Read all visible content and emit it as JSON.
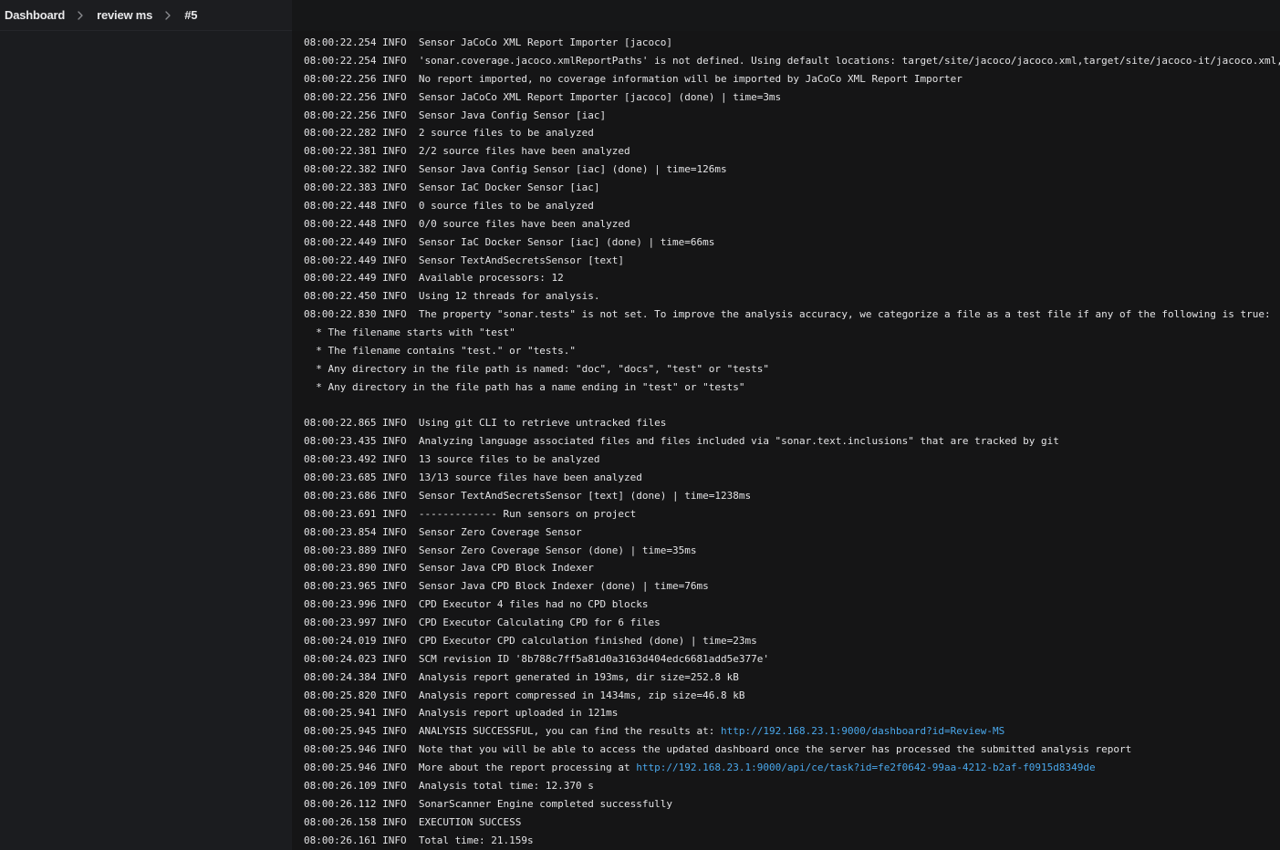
{
  "breadcrumb": {
    "items": [
      "Dashboard",
      "review ms",
      "#5"
    ]
  },
  "colors": {
    "link": "#4aa8ec",
    "text": "#e4e4e6",
    "console_bg": "#151516"
  },
  "log": {
    "lines": [
      {
        "text": "08:00:22.254 INFO  Sensor JaCoCo XML Report Importer [jacoco]"
      },
      {
        "text": "08:00:22.254 INFO  'sonar.coverage.jacoco.xmlReportPaths' is not defined. Using default locations: target/site/jacoco/jacoco.xml,target/site/jacoco-it/jacoco.xml,build/reports/jacoco/test/jacocoTestReport.xml"
      },
      {
        "text": "08:00:22.256 INFO  No report imported, no coverage information will be imported by JaCoCo XML Report Importer"
      },
      {
        "text": "08:00:22.256 INFO  Sensor JaCoCo XML Report Importer [jacoco] (done) | time=3ms"
      },
      {
        "text": "08:00:22.256 INFO  Sensor Java Config Sensor [iac]"
      },
      {
        "text": "08:00:22.282 INFO  2 source files to be analyzed"
      },
      {
        "text": "08:00:22.381 INFO  2/2 source files have been analyzed"
      },
      {
        "text": "08:00:22.382 INFO  Sensor Java Config Sensor [iac] (done) | time=126ms"
      },
      {
        "text": "08:00:22.383 INFO  Sensor IaC Docker Sensor [iac]"
      },
      {
        "text": "08:00:22.448 INFO  0 source files to be analyzed"
      },
      {
        "text": "08:00:22.448 INFO  0/0 source files have been analyzed"
      },
      {
        "text": "08:00:22.449 INFO  Sensor IaC Docker Sensor [iac] (done) | time=66ms"
      },
      {
        "text": "08:00:22.449 INFO  Sensor TextAndSecretsSensor [text]"
      },
      {
        "text": "08:00:22.449 INFO  Available processors: 12"
      },
      {
        "text": "08:00:22.450 INFO  Using 12 threads for analysis."
      },
      {
        "text": "08:00:22.830 INFO  The property \"sonar.tests\" is not set. To improve the analysis accuracy, we categorize a file as a test file if any of the following is true:"
      },
      {
        "text": "  * The filename starts with \"test\""
      },
      {
        "text": "  * The filename contains \"test.\" or \"tests.\""
      },
      {
        "text": "  * Any directory in the file path is named: \"doc\", \"docs\", \"test\" or \"tests\""
      },
      {
        "text": "  * Any directory in the file path has a name ending in \"test\" or \"tests\""
      },
      {
        "text": ""
      },
      {
        "text": "08:00:22.865 INFO  Using git CLI to retrieve untracked files"
      },
      {
        "text": "08:00:23.435 INFO  Analyzing language associated files and files included via \"sonar.text.inclusions\" that are tracked by git"
      },
      {
        "text": "08:00:23.492 INFO  13 source files to be analyzed"
      },
      {
        "text": "08:00:23.685 INFO  13/13 source files have been analyzed"
      },
      {
        "text": "08:00:23.686 INFO  Sensor TextAndSecretsSensor [text] (done) | time=1238ms"
      },
      {
        "text": "08:00:23.691 INFO  ------------- Run sensors on project"
      },
      {
        "text": "08:00:23.854 INFO  Sensor Zero Coverage Sensor"
      },
      {
        "text": "08:00:23.889 INFO  Sensor Zero Coverage Sensor (done) | time=35ms"
      },
      {
        "text": "08:00:23.890 INFO  Sensor Java CPD Block Indexer"
      },
      {
        "text": "08:00:23.965 INFO  Sensor Java CPD Block Indexer (done) | time=76ms"
      },
      {
        "text": "08:00:23.996 INFO  CPD Executor 4 files had no CPD blocks"
      },
      {
        "text": "08:00:23.997 INFO  CPD Executor Calculating CPD for 6 files"
      },
      {
        "text": "08:00:24.019 INFO  CPD Executor CPD calculation finished (done) | time=23ms"
      },
      {
        "text": "08:00:24.023 INFO  SCM revision ID '8b788c7ff5a81d0a3163d404edc6681add5e377e'"
      },
      {
        "text": "08:00:24.384 INFO  Analysis report generated in 193ms, dir size=252.8 kB"
      },
      {
        "text": "08:00:25.820 INFO  Analysis report compressed in 1434ms, zip size=46.8 kB"
      },
      {
        "text": "08:00:25.941 INFO  Analysis report uploaded in 121ms"
      },
      {
        "text": "08:00:25.945 INFO  ANALYSIS SUCCESSFUL, you can find the results at: ",
        "link": "http://192.168.23.1:9000/dashboard?id=Review-MS"
      },
      {
        "text": "08:00:25.946 INFO  Note that you will be able to access the updated dashboard once the server has processed the submitted analysis report"
      },
      {
        "text": "08:00:25.946 INFO  More about the report processing at ",
        "link": "http://192.168.23.1:9000/api/ce/task?id=fe2f0642-99aa-4212-b2af-f0915d8349de"
      },
      {
        "text": "08:00:26.109 INFO  Analysis total time: 12.370 s"
      },
      {
        "text": "08:00:26.112 INFO  SonarScanner Engine completed successfully"
      },
      {
        "text": "08:00:26.158 INFO  EXECUTION SUCCESS"
      },
      {
        "text": "08:00:26.161 INFO  Total time: 21.159s"
      }
    ]
  }
}
